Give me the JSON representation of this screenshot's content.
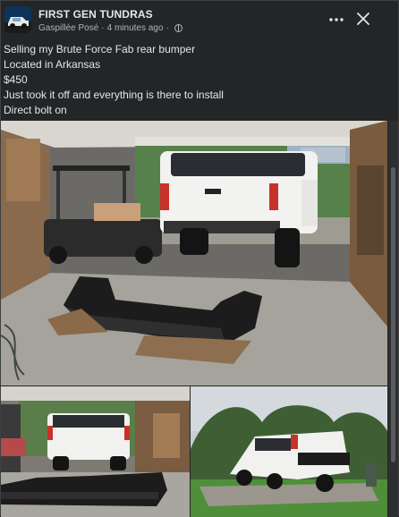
{
  "post": {
    "group_name": "FIRST GEN TUNDRAS",
    "author": "Gaspillée Posé",
    "time": "4 minutes ago",
    "separator": "·",
    "lines": [
      "Selling my Brute Force Fab rear bumper",
      "Located in Arkansas",
      "$450",
      "Just took it off and everything is there to install",
      "Direct bolt on"
    ]
  },
  "icons": {
    "more": "more-options-icon",
    "close": "close-icon",
    "privacy": "globe-icon"
  },
  "colors": {
    "card_bg": "#242526",
    "text_primary": "#e4e6eb",
    "text_secondary": "#b0b3b8",
    "truck_white": "#f2f2f0"
  }
}
